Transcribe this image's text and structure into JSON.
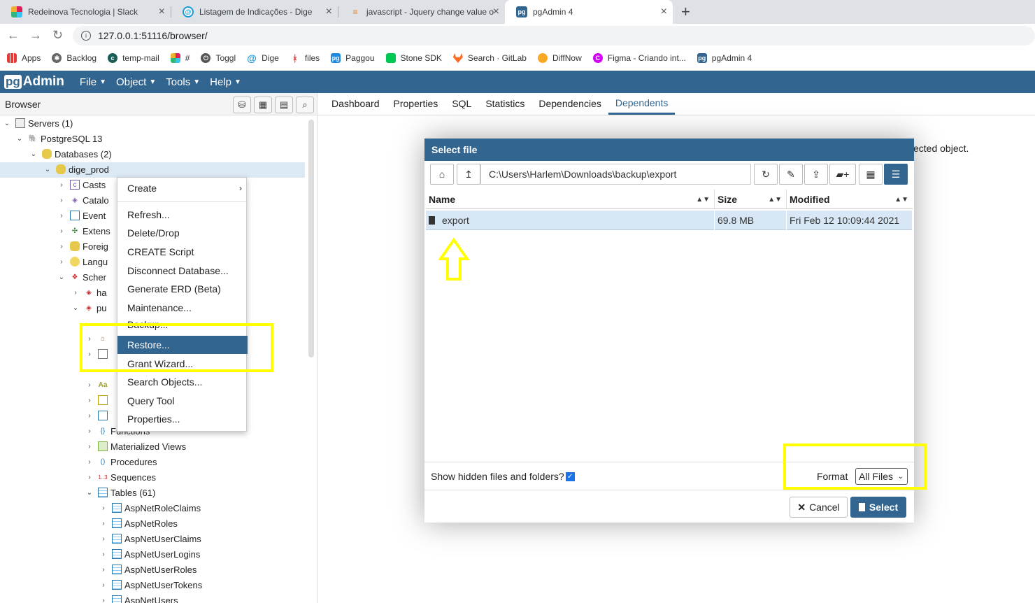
{
  "browser_tabs": [
    {
      "title": "Redeinova Tecnologia | Slack",
      "icon": "slack-icon"
    },
    {
      "title": "Listagem de Indicações - Dige",
      "icon": "dige-icon"
    },
    {
      "title": "javascript - Jquery change value o",
      "icon": "stackoverflow-icon"
    },
    {
      "title": "pgAdmin 4",
      "icon": "pgadmin-icon"
    }
  ],
  "url": "127.0.0.1:51116/browser/",
  "bookmarks": [
    "Apps",
    "Backlog",
    "temp-mail",
    "#",
    "Toggl",
    "Dige",
    "files",
    "Paggou",
    "Stone SDK",
    "Search · GitLab",
    "DiffNow",
    "Figma - Criando int...",
    "pgAdmin 4"
  ],
  "app": {
    "logo_pg": "pg",
    "logo_text": "Admin",
    "menus": [
      "File",
      "Object",
      "Tools",
      "Help"
    ]
  },
  "browser_panel": {
    "title": "Browser"
  },
  "tree": {
    "servers": "Servers (1)",
    "pg13": "PostgreSQL 13",
    "databases": "Databases (2)",
    "dige": "dige_prod",
    "casts": "Casts",
    "catalogs": "Catalo",
    "event": "Event",
    "extens": "Extens",
    "foreign": "Foreig",
    "languages": "Langu",
    "schemas": "Scher",
    "ha": "ha",
    "pu": "pu",
    "functions": "Functions",
    "matviews": "Materialized Views",
    "procedures": "Procedures",
    "sequences": "Sequences",
    "tables": "Tables (61)",
    "t1": "AspNetRoleClaims",
    "t2": "AspNetRoles",
    "t3": "AspNetUserClaims",
    "t4": "AspNetUserLogins",
    "t5": "AspNetUserRoles",
    "t6": "AspNetUserTokens",
    "t7": "AspNetUsers"
  },
  "main_tabs": [
    "Dashboard",
    "Properties",
    "SQL",
    "Statistics",
    "Dependencies",
    "Dependents"
  ],
  "hint_text": "ected object.",
  "context_menu": [
    "Create",
    "Refresh...",
    "Delete/Drop",
    "CREATE Script",
    "Disconnect Database...",
    "Generate ERD (Beta)",
    "Maintenance...",
    "Backup...",
    "Restore...",
    "Grant Wizard...",
    "Search Objects...",
    "Query Tool",
    "Properties..."
  ],
  "dialog": {
    "title": "Select file",
    "path": "C:\\Users\\Harlem\\Downloads\\backup\\export",
    "columns": [
      "Name",
      "Size",
      "Modified"
    ],
    "file": {
      "name": "export",
      "size": "69.8 MB",
      "modified": "Fri Feb 12 10:09:44 2021"
    },
    "hidden_label": "Show hidden files and folders?",
    "format_label": "Format",
    "format_value": "All Files",
    "cancel": "Cancel",
    "select": "Select"
  },
  "colors": {
    "brand": "#326690",
    "highlight": "#ffff00",
    "selected_row": "#d7e7f5"
  }
}
